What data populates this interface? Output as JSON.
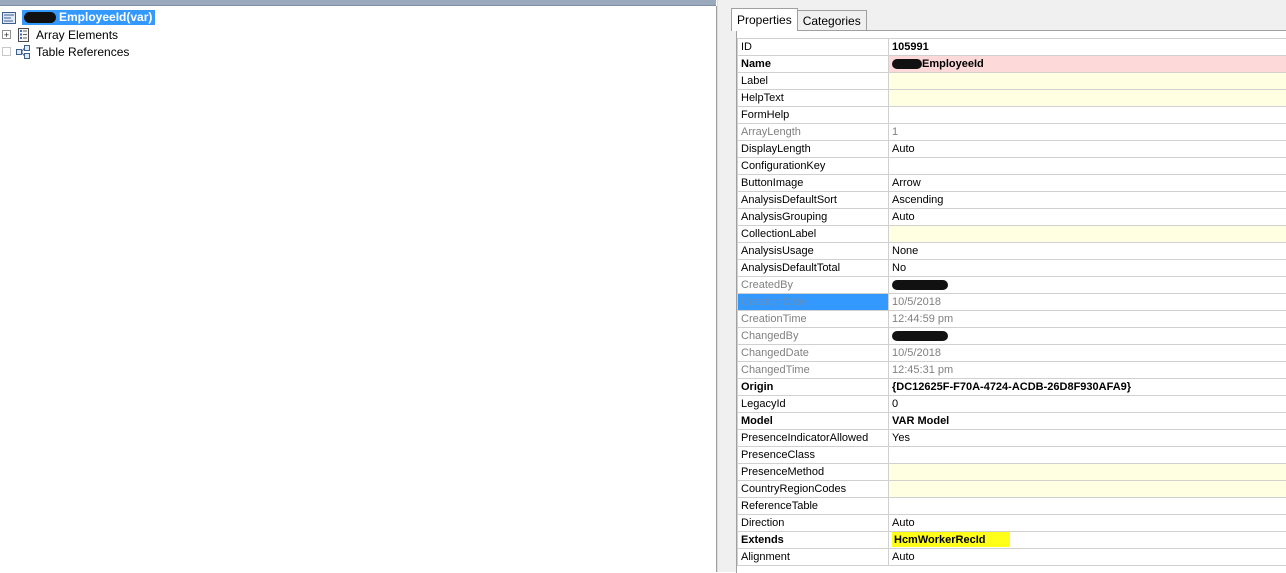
{
  "tree": {
    "root": {
      "label": "EmployeeId(var)",
      "icon": "edt-node-icon"
    },
    "children": [
      {
        "label": "Array Elements",
        "icon": "array-elements-icon",
        "expander": "+"
      },
      {
        "label": "Table References",
        "icon": "table-references-icon",
        "expander": ""
      }
    ]
  },
  "tabs": [
    {
      "label": "Properties",
      "active": true
    },
    {
      "label": "Categories",
      "active": false
    }
  ],
  "properties": [
    {
      "key": "ID",
      "value": "105991",
      "style": "bold-value"
    },
    {
      "key": "Name",
      "value": "EmployeeId",
      "style": "bold",
      "fill": "pink",
      "redacted_prefix": true
    },
    {
      "key": "Label",
      "value": "",
      "fill": "cream"
    },
    {
      "key": "HelpText",
      "value": "",
      "fill": "cream"
    },
    {
      "key": "FormHelp",
      "value": ""
    },
    {
      "key": "ArrayLength",
      "value": "1",
      "style": "grey"
    },
    {
      "key": "DisplayLength",
      "value": "Auto"
    },
    {
      "key": "ConfigurationKey",
      "value": ""
    },
    {
      "key": "ButtonImage",
      "value": "Arrow"
    },
    {
      "key": "AnalysisDefaultSort",
      "value": "Ascending"
    },
    {
      "key": "AnalysisGrouping",
      "value": "Auto"
    },
    {
      "key": "CollectionLabel",
      "value": "",
      "fill": "cream"
    },
    {
      "key": "AnalysisUsage",
      "value": "None"
    },
    {
      "key": "AnalysisDefaultTotal",
      "value": "No"
    },
    {
      "key": "CreatedBy",
      "value": "",
      "style": "grey",
      "redacted": true
    },
    {
      "key": "CreationDate",
      "value": "10/5/2018",
      "style": "grey",
      "selected": true
    },
    {
      "key": "CreationTime",
      "value": "12:44:59 pm",
      "style": "grey"
    },
    {
      "key": "ChangedBy",
      "value": "",
      "style": "grey",
      "redacted": true
    },
    {
      "key": "ChangedDate",
      "value": "10/5/2018",
      "style": "grey"
    },
    {
      "key": "ChangedTime",
      "value": "12:45:31 pm",
      "style": "grey"
    },
    {
      "key": "Origin",
      "value": "{DC12625F-F70A-4724-ACDB-26D8F930AFA9}",
      "style": "bold"
    },
    {
      "key": "LegacyId",
      "value": "0"
    },
    {
      "key": "Model",
      "value": "VAR Model",
      "style": "bold"
    },
    {
      "key": "PresenceIndicatorAllowed",
      "value": "Yes"
    },
    {
      "key": "PresenceClass",
      "value": ""
    },
    {
      "key": "PresenceMethod",
      "value": "",
      "fill": "cream"
    },
    {
      "key": "CountryRegionCodes",
      "value": "",
      "fill": "cream"
    },
    {
      "key": "ReferenceTable",
      "value": ""
    },
    {
      "key": "Direction",
      "value": "Auto"
    },
    {
      "key": "Extends",
      "value": "HcmWorkerRecId",
      "style": "bold",
      "highlight": "#ffff1a"
    },
    {
      "key": "Alignment",
      "value": "Auto"
    }
  ],
  "colors": {
    "selection": "#3399ff",
    "name_fill": "#fdd9d9",
    "cream_fill": "#ffffe1",
    "marker": "#ffff1a"
  }
}
